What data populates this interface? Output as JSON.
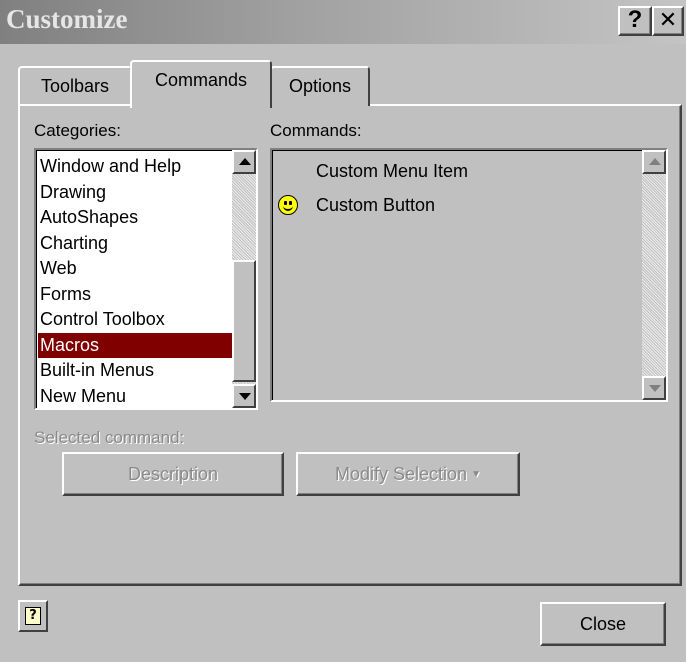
{
  "window": {
    "title": "Customize",
    "help_glyph": "?",
    "close_glyph": "✕"
  },
  "tabs": [
    {
      "label": "Toolbars",
      "active": false
    },
    {
      "label": "Commands",
      "active": true
    },
    {
      "label": "Options",
      "active": false
    }
  ],
  "categories": {
    "label": "Categories:",
    "items": [
      "Window and Help",
      "Drawing",
      "AutoShapes",
      "Charting",
      "Web",
      "Forms",
      "Control Toolbox",
      "Macros",
      "Built-in Menus",
      "New Menu"
    ],
    "selected": "Macros"
  },
  "commands": {
    "label": "Commands:",
    "items": [
      {
        "label": "Custom Menu Item",
        "icon": null
      },
      {
        "label": "Custom Button",
        "icon": "smiley-icon"
      }
    ]
  },
  "selected_command": {
    "label": "Selected command:",
    "description_button": "Description",
    "modify_button": "Modify Selection",
    "modify_caret": "▼"
  },
  "footer": {
    "help_icon_glyph": "?",
    "close_button": "Close"
  },
  "colors": {
    "selection": "#800000",
    "face": "#c0c0c0"
  }
}
